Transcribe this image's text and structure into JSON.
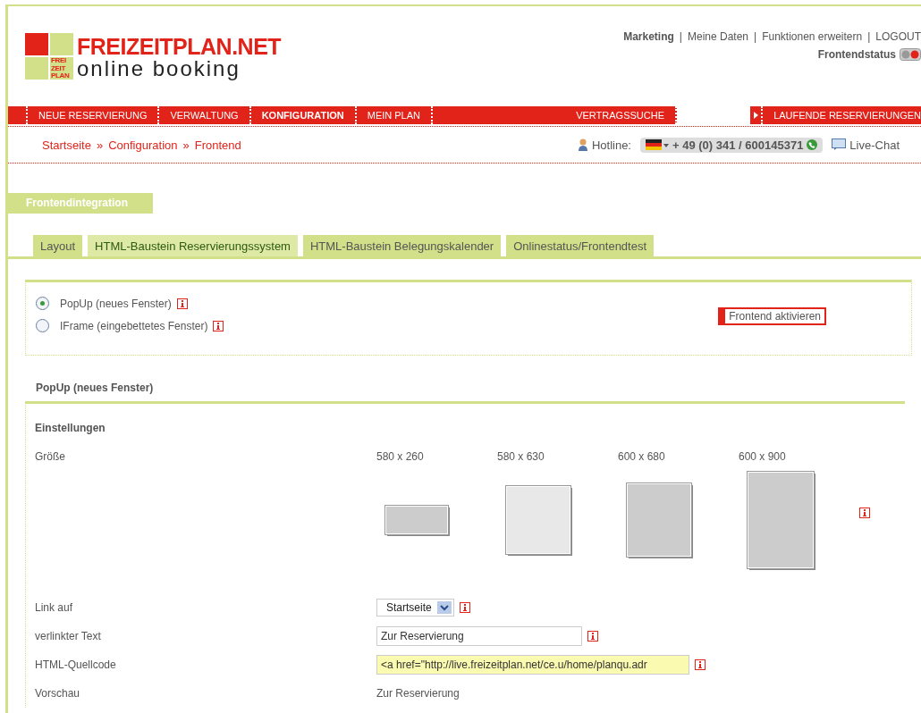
{
  "logo": {
    "title": "FREIZEITPLAN.NET",
    "subtitle": "online booking",
    "mark_lines": [
      "FREI",
      "ZEIT",
      "PLAN"
    ]
  },
  "top_links": [
    "Marketing",
    "Meine Daten",
    "Funktionen erweitern",
    "LOGOUT"
  ],
  "top_link_separator": "|",
  "frontend_status": {
    "label": "Frontendstatus",
    "on": false
  },
  "nav": [
    {
      "label": "NEUE RESERVIERUNG",
      "selected": false
    },
    {
      "label": "VERWALTUNG",
      "selected": false
    },
    {
      "label": "KONFIGURATION",
      "selected": true
    },
    {
      "label": "MEIN PLAN",
      "selected": false
    },
    {
      "label": "VERTRAGSSUCHE",
      "selected": false
    }
  ],
  "nav_right": {
    "label": "LAUFENDE RESERVIERUNGEN"
  },
  "breadcrumb": [
    "Startseite",
    "Configuration",
    "Frontend"
  ],
  "breadcrumb_separator": "»",
  "hotline": {
    "label": "Hotline:",
    "number": "+ 49 (0) 341 / 600145371",
    "chat": "Live-Chat"
  },
  "section_title": "Frontendintegration",
  "tabs": [
    {
      "label": "Layout",
      "selected": false
    },
    {
      "label": "HTML-Baustein Reservierungssystem",
      "selected": true
    },
    {
      "label": "HTML-Baustein Belegungskalender",
      "selected": false
    },
    {
      "label": "Onlinestatus/Frontendtest",
      "selected": false
    }
  ],
  "modes": [
    {
      "label": "PopUp (neues Fenster)",
      "selected": true
    },
    {
      "label": "IFrame (eingebettetes Fenster)",
      "selected": false
    }
  ],
  "activate_button": "Frontend aktivieren",
  "popup_title": "PopUp (neues Fenster)",
  "settings": {
    "title": "Einstellungen",
    "size_label": "Größe",
    "sizes": [
      "580 x 260",
      "580 x 630",
      "600 x 680",
      "600 x 900"
    ],
    "link_label": "Link auf",
    "link_value": "Startseite",
    "text_label": "verlinkter Text",
    "text_value": "Zur Reservierung",
    "code_label": "HTML-Quellcode",
    "code_value": "<a href=\"http://live.freizeitplan.net/ce.u/home/planqu.adr",
    "preview_label": "Vorschau",
    "preview_value": "Zur Reservierung"
  }
}
